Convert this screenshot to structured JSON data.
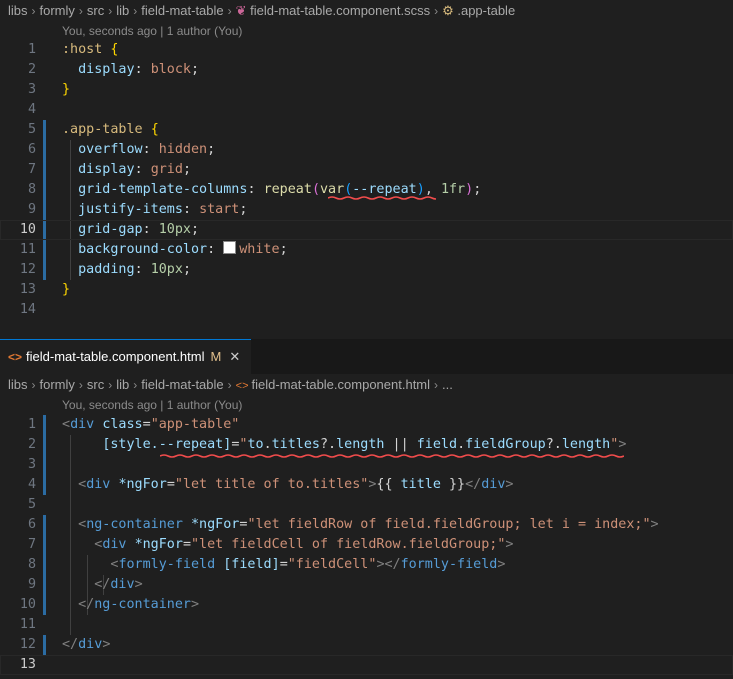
{
  "top_editor": {
    "breadcrumb": [
      {
        "label": "libs",
        "icon": ""
      },
      {
        "label": "formly",
        "icon": ""
      },
      {
        "label": "src",
        "icon": ""
      },
      {
        "label": "lib",
        "icon": ""
      },
      {
        "label": "field-mat-table",
        "icon": ""
      },
      {
        "label": "field-mat-table.component.scss",
        "icon": "scss-icon"
      },
      {
        "label": ".app-table",
        "icon": "css-selector-icon"
      }
    ],
    "blame": "You, seconds ago | 1 author (You)",
    "lines": [
      {
        "n": "1",
        "tokens": [
          [
            "t-sel",
            ":host"
          ],
          [
            "t-punc",
            " "
          ],
          [
            "t-br1",
            "{"
          ]
        ]
      },
      {
        "n": "2",
        "tokens": [
          [
            "t-punc",
            "  "
          ],
          [
            "t-prop",
            "display"
          ],
          [
            "t-punc",
            ": "
          ],
          [
            "t-val",
            "block"
          ],
          [
            "t-punc",
            ";"
          ]
        ]
      },
      {
        "n": "3",
        "tokens": [
          [
            "t-br1",
            "}"
          ]
        ]
      },
      {
        "n": "4",
        "tokens": []
      },
      {
        "n": "5",
        "tokens": [
          [
            "t-sel",
            ".app-table"
          ],
          [
            "t-punc",
            " "
          ],
          [
            "t-br1",
            "{"
          ]
        ]
      },
      {
        "n": "6",
        "tokens": [
          [
            "t-punc",
            "  "
          ],
          [
            "t-prop",
            "overflow"
          ],
          [
            "t-punc",
            ": "
          ],
          [
            "t-val",
            "hidden"
          ],
          [
            "t-punc",
            ";"
          ]
        ]
      },
      {
        "n": "7",
        "tokens": [
          [
            "t-punc",
            "  "
          ],
          [
            "t-prop",
            "display"
          ],
          [
            "t-punc",
            ": "
          ],
          [
            "t-val",
            "grid"
          ],
          [
            "t-punc",
            ";"
          ]
        ]
      },
      {
        "n": "8",
        "tokens": [
          [
            "t-punc",
            "  "
          ],
          [
            "t-prop",
            "grid-template-columns"
          ],
          [
            "t-punc",
            ": "
          ],
          [
            "t-fn",
            "repeat"
          ],
          [
            "t-br2",
            "("
          ],
          [
            "t-fn",
            "var"
          ],
          [
            "t-br3",
            "("
          ],
          [
            "t-prop",
            "--repeat"
          ],
          [
            "t-br3",
            ")"
          ],
          [
            "t-punc",
            ", "
          ],
          [
            "t-num",
            "1fr"
          ],
          [
            "t-br2",
            ")"
          ],
          [
            "t-punc",
            ";"
          ]
        ]
      },
      {
        "n": "9",
        "tokens": [
          [
            "t-punc",
            "  "
          ],
          [
            "t-prop",
            "justify-items"
          ],
          [
            "t-punc",
            ": "
          ],
          [
            "t-val",
            "start"
          ],
          [
            "t-punc",
            ";"
          ]
        ]
      },
      {
        "n": "10",
        "tokens": [
          [
            "t-punc",
            "  "
          ],
          [
            "t-prop",
            "grid-gap"
          ],
          [
            "t-punc",
            ": "
          ],
          [
            "t-num",
            "10px"
          ],
          [
            "t-punc",
            ";"
          ]
        ]
      },
      {
        "n": "11",
        "tokens": [
          [
            "t-punc",
            "  "
          ],
          [
            "t-prop",
            "background-color"
          ],
          [
            "t-punc",
            ": "
          ],
          [
            "swatch",
            ""
          ],
          [
            "t-val",
            "white"
          ],
          [
            "t-punc",
            ";"
          ]
        ]
      },
      {
        "n": "12",
        "tokens": [
          [
            "t-punc",
            "  "
          ],
          [
            "t-prop",
            "padding"
          ],
          [
            "t-punc",
            ": "
          ],
          [
            "t-num",
            "10px"
          ],
          [
            "t-punc",
            ";"
          ]
        ]
      },
      {
        "n": "13",
        "tokens": [
          [
            "t-br1",
            "}"
          ]
        ]
      },
      {
        "n": "14",
        "tokens": []
      }
    ]
  },
  "bottom_editor": {
    "tab": {
      "label": "field-mat-table.component.html",
      "modified": "M",
      "close": "✕",
      "icon": "html-icon"
    },
    "breadcrumb": [
      {
        "label": "libs",
        "icon": ""
      },
      {
        "label": "formly",
        "icon": ""
      },
      {
        "label": "src",
        "icon": ""
      },
      {
        "label": "lib",
        "icon": ""
      },
      {
        "label": "field-mat-table",
        "icon": ""
      },
      {
        "label": "field-mat-table.component.html",
        "icon": "html-icon"
      },
      {
        "label": "...",
        "icon": ""
      }
    ],
    "blame": "You, seconds ago | 1 author (You)",
    "lines": [
      {
        "n": "1",
        "tokens": [
          [
            "t-tag",
            "<"
          ],
          [
            "t-tagname",
            "div"
          ],
          [
            "t-text",
            " "
          ],
          [
            "t-attr",
            "class"
          ],
          [
            "t-text",
            "="
          ],
          [
            "t-str",
            "\"app-table\""
          ]
        ]
      },
      {
        "n": "2",
        "tokens": [
          [
            "t-text",
            "     "
          ],
          [
            "t-attr",
            "[style.--repeat]"
          ],
          [
            "t-text",
            "="
          ],
          [
            "t-str",
            "\""
          ],
          [
            "t-attr",
            "to"
          ],
          [
            "t-text",
            "."
          ],
          [
            "t-attr",
            "titles"
          ],
          [
            "t-text",
            "?."
          ],
          [
            "t-attr",
            "length"
          ],
          [
            "t-text",
            " || "
          ],
          [
            "t-attr",
            "field"
          ],
          [
            "t-text",
            "."
          ],
          [
            "t-attr",
            "fieldGroup"
          ],
          [
            "t-text",
            "?."
          ],
          [
            "t-attr",
            "length"
          ],
          [
            "t-str",
            "\""
          ],
          [
            "t-tag",
            ">"
          ]
        ]
      },
      {
        "n": "3",
        "tokens": []
      },
      {
        "n": "4",
        "tokens": [
          [
            "t-text",
            "  "
          ],
          [
            "t-tag",
            "<"
          ],
          [
            "t-tagname",
            "div"
          ],
          [
            "t-text",
            " "
          ],
          [
            "t-attr",
            "*ngFor"
          ],
          [
            "t-text",
            "="
          ],
          [
            "t-str",
            "\"let title of to.titles\""
          ],
          [
            "t-tag",
            ">"
          ],
          [
            "t-text",
            "{{ "
          ],
          [
            "t-attr",
            "title"
          ],
          [
            "t-text",
            " }}"
          ],
          [
            "t-tag",
            "</"
          ],
          [
            "t-tagname",
            "div"
          ],
          [
            "t-tag",
            ">"
          ]
        ]
      },
      {
        "n": "5",
        "tokens": []
      },
      {
        "n": "6",
        "tokens": [
          [
            "t-text",
            "  "
          ],
          [
            "t-tag",
            "<"
          ],
          [
            "t-tagname",
            "ng-container"
          ],
          [
            "t-text",
            " "
          ],
          [
            "t-attr",
            "*ngFor"
          ],
          [
            "t-text",
            "="
          ],
          [
            "t-str",
            "\"let fieldRow of field.fieldGroup; let i = index;\""
          ],
          [
            "t-tag",
            ">"
          ]
        ]
      },
      {
        "n": "7",
        "tokens": [
          [
            "t-text",
            "    "
          ],
          [
            "t-tag",
            "<"
          ],
          [
            "t-tagname",
            "div"
          ],
          [
            "t-text",
            " "
          ],
          [
            "t-attr",
            "*ngFor"
          ],
          [
            "t-text",
            "="
          ],
          [
            "t-str",
            "\"let fieldCell of fieldRow.fieldGroup;\""
          ],
          [
            "t-tag",
            ">"
          ]
        ]
      },
      {
        "n": "8",
        "tokens": [
          [
            "t-text",
            "      "
          ],
          [
            "t-tag",
            "<"
          ],
          [
            "t-tagname",
            "formly-field"
          ],
          [
            "t-text",
            " "
          ],
          [
            "t-attr",
            "[field]"
          ],
          [
            "t-text",
            "="
          ],
          [
            "t-str",
            "\"fieldCell\""
          ],
          [
            "t-tag",
            "></"
          ],
          [
            "t-tagname",
            "formly-field"
          ],
          [
            "t-tag",
            ">"
          ]
        ]
      },
      {
        "n": "9",
        "tokens": [
          [
            "t-text",
            "    "
          ],
          [
            "t-tag",
            "</"
          ],
          [
            "t-tagname",
            "div"
          ],
          [
            "t-tag",
            ">"
          ]
        ]
      },
      {
        "n": "10",
        "tokens": [
          [
            "t-text",
            "  "
          ],
          [
            "t-tag",
            "</"
          ],
          [
            "t-tagname",
            "ng-container"
          ],
          [
            "t-tag",
            ">"
          ]
        ]
      },
      {
        "n": "11",
        "tokens": []
      },
      {
        "n": "12",
        "tokens": [
          [
            "t-tag",
            "</"
          ],
          [
            "t-tagname",
            "div"
          ],
          [
            "t-tag",
            ">"
          ]
        ]
      },
      {
        "n": "13",
        "tokens": []
      }
    ]
  },
  "colors": {
    "accent": "#0078d4",
    "squiggle": "#f14c4c"
  }
}
